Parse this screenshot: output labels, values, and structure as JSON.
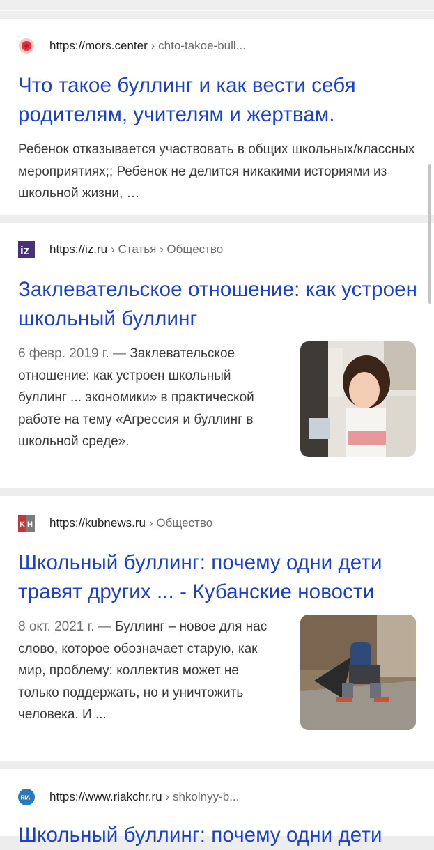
{
  "results": [
    {
      "url": "https://mors.center",
      "crumbs": "› chto-takoe-bull...",
      "favicon": "mors-logo",
      "title": "Что такое буллинг и как вести себя родителям, учителям и жертвам.",
      "date": "",
      "snippet": "Ребенок отказывается участвовать в общих школьных/классных мероприятиях;; Ребенок не делится никакими историями из школьной жизни, …"
    },
    {
      "url": "https://iz.ru",
      "crumbs": "› Статья › Общество",
      "favicon": "iz-logo",
      "title": "Заклевательское отношение: как устроен школьный буллинг",
      "date": "6 февр. 2019 г. —",
      "snippet": "Заклевательское отношение: как устроен школьный буллинг ... экономики» в практической работе на тему «Агрессия и буллинг в школьной среде».",
      "thumbnail": "girl-in-school-photo"
    },
    {
      "url": "https://kubnews.ru",
      "crumbs": "› Общество",
      "favicon": "kubnews-logo",
      "title": "Школьный буллинг: почему одни дети травят других ... - Кубанские новости",
      "date": "8 окт. 2021 г. —",
      "snippet": "Буллинг – новое для нас слово, которое обозначает старую, как мир, проблему: коллектив может не только поддержать, но и уничтожить человека. И ...",
      "thumbnail": "sitting-child-photo"
    },
    {
      "url": "https://www.riakchr.ru",
      "crumbs": "› shkolnyy-b...",
      "favicon": "ria-logo",
      "title": "Школьный буллинг: почему одни дети"
    }
  ],
  "colors": {
    "link": "#1a3fd1",
    "background": "#ededed",
    "card": "#ffffff"
  }
}
